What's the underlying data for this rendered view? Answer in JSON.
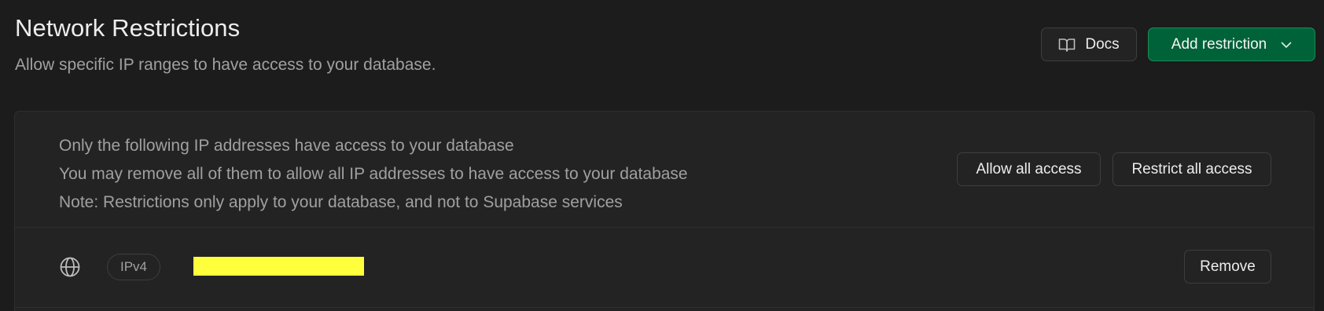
{
  "header": {
    "title": "Network Restrictions",
    "subtitle": "Allow specific IP ranges to have access to your database.",
    "docs_label": "Docs",
    "docs_icon": "book-open-icon",
    "add_label": "Add restriction",
    "add_icon": "chevron-down-icon"
  },
  "panel": {
    "info_lines": [
      "Only the following IP addresses have access to your database",
      "You may remove all of them to allow all IP addresses to have access to your database",
      "Note: Restrictions only apply to your database, and not to Supabase services"
    ],
    "allow_all_label": "Allow all access",
    "restrict_all_label": "Restrict all access"
  },
  "restrictions": [
    {
      "icon": "globe-icon",
      "type": "IPv4",
      "address": "",
      "remove_label": "Remove"
    }
  ],
  "colors": {
    "background": "#1c1c1c",
    "panel": "#232323",
    "brand_green": "#006239",
    "redaction": "#ffff3b"
  }
}
